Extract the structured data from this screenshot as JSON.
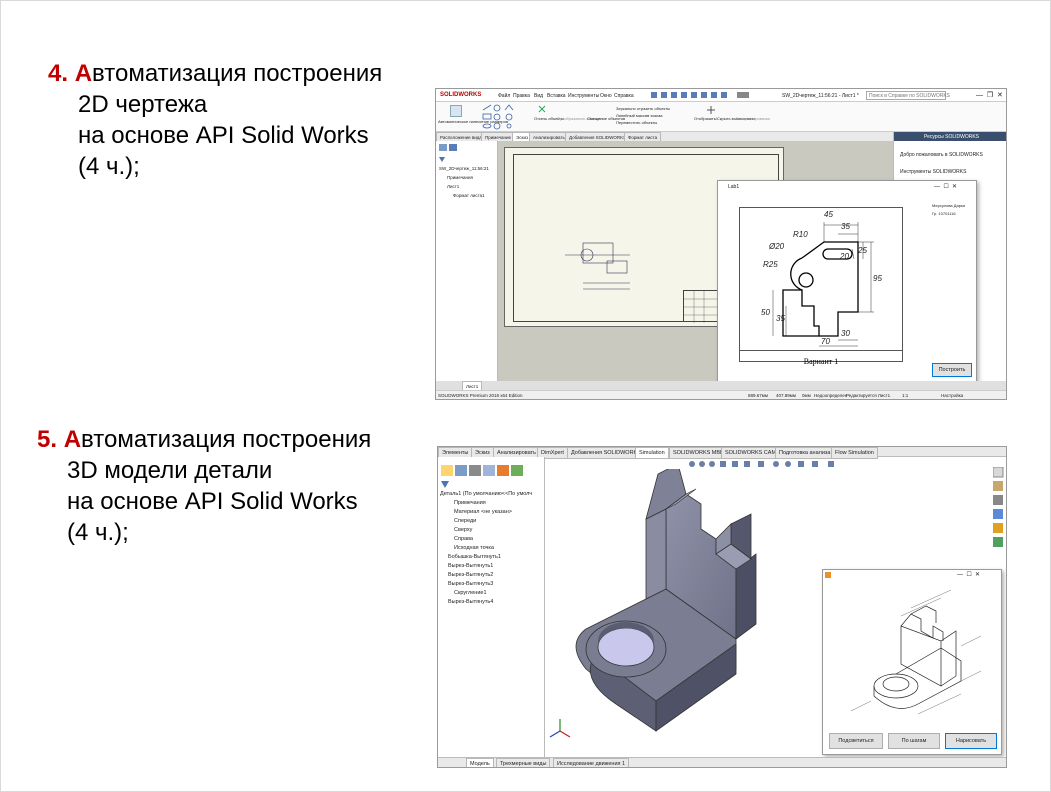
{
  "slide": {
    "item4": {
      "number": "4. ",
      "lines": [
        "Автоматизация построения",
        "2D чертежа",
        "на основе API Solid Works",
        "(4 ч.);"
      ]
    },
    "item5": {
      "number": "5. ",
      "lines": [
        "Автоматизация построения",
        "3D модели детали",
        "на основе API Solid Works",
        "(4 ч.);"
      ]
    }
  },
  "shot2d": {
    "logo": "SOLIDWORKS",
    "menu": [
      "Файл",
      "Правка",
      "Вид",
      "Вставка",
      "Инструменты",
      "Окно",
      "Справка"
    ],
    "doc_title": "SW_2Dчертеж_11:56:21 - Лист1 *",
    "search_placeholder": "Поиск в Справке по SOLIDWORKS",
    "toolbar": {
      "auto_dims": "Автоматическое нанесение размеров",
      "offset": "Отсечь объекты",
      "convert": "Преобразовать объекты",
      "smart": "Смещение объектов",
      "mirror": "Зеркально отразить объекты",
      "linear": "Линейный массив эскиза",
      "move": "Переместить объекты",
      "show_hide": "Отобразить/Скрыть взаимосвязи",
      "quick": "Быстрое привязки"
    },
    "tabs": [
      "Расположение вида",
      "Примечание",
      "Эскиз",
      "Анализировать",
      "Добавления SOLIDWORKS",
      "Формат листа"
    ],
    "tree": [
      "SW_2Dчертеж_11:56:21",
      "Примечания",
      "Лист1",
      "Формат листа1"
    ],
    "resources": {
      "title": "Ресурсы SOLIDWORKS",
      "welcome": "Добро пожаловать в SOLIDWORKS",
      "tools": "Инструменты SOLIDWORKS"
    },
    "dialog": {
      "title": "Lab1",
      "author": "Мерсулова Дарья",
      "group": "Гр. 10701116",
      "button": "Построить",
      "variant": "Вариант 1",
      "dims": [
        "45",
        "35",
        "R10",
        "Ø20",
        "R25",
        "20",
        "25",
        "95",
        "50",
        "35",
        "30",
        "70"
      ]
    },
    "sheet_tab": "Лист1",
    "status": [
      "SOLIDWORKS Premium 2018 x64 Edition",
      "889.67мм",
      "407.89мм",
      "0мм",
      "Недоопределен",
      "Редактируется Лист1",
      "1:1",
      "Настройка"
    ]
  },
  "shot3d": {
    "tabs": [
      "Элементы",
      "Эскиз",
      "Анализировать",
      "DimXpert",
      "Добавления SOLIDWORKS",
      "Simulation",
      "SOLIDWORKS MBD",
      "SOLIDWORKS CAM",
      "Подготовка анализа",
      "Flow Simulation"
    ],
    "tree": [
      "Деталь1 (По умолчанию<<По умолч",
      "Примечания",
      "Материал <не указан>",
      "Спереди",
      "Сверху",
      "Справа",
      "Исходная точка",
      "Бобышка-Вытянуть1",
      "Вырез-Вытянуть1",
      "Вырез-Вытянуть2",
      "Вырез-Вытянуть3",
      "Скругление1",
      "Вырез-Вытянуть4"
    ],
    "bottom_tabs": [
      "Модель",
      "Трехмерные виды",
      "Исследование движения 1"
    ],
    "dialog": {
      "buttons": [
        "Подсветиться",
        "По шагам",
        "Нарисовать"
      ]
    }
  }
}
